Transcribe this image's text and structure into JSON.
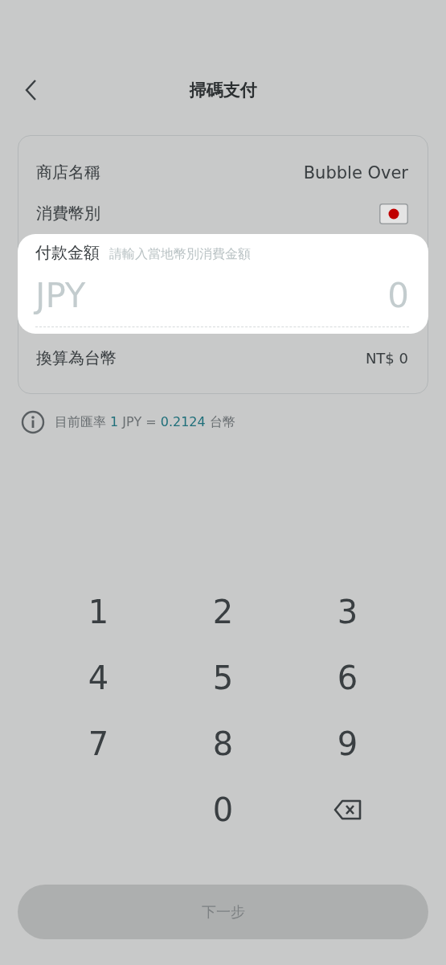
{
  "header": {
    "title": "掃碼支付"
  },
  "details": [
    {
      "label": "商店名稱",
      "value": "Bubble Over",
      "kind": "text"
    },
    {
      "label": "消費幣別",
      "kind": "flag"
    }
  ],
  "amount": {
    "label": "付款金額",
    "placeholder": "請輸入當地幣別消費金額",
    "currency": "JPY",
    "value": "0",
    "selected": true
  },
  "conversion": {
    "label": "換算為台幣",
    "value": "NT$ 0"
  },
  "rate": [
    {
      "text": "目前匯率 ",
      "highlight": false
    },
    {
      "text": "1",
      "highlight": true
    },
    {
      "text": " JPY = ",
      "highlight": false
    },
    {
      "text": "0.2124",
      "highlight": true
    },
    {
      "text": " 台幣",
      "highlight": false
    }
  ],
  "keypad": [
    {
      "kind": "digit",
      "label": "1"
    },
    {
      "kind": "digit",
      "label": "2"
    },
    {
      "kind": "digit",
      "label": "3"
    },
    {
      "kind": "digit",
      "label": "4"
    },
    {
      "kind": "digit",
      "label": "5"
    },
    {
      "kind": "digit",
      "label": "6"
    },
    {
      "kind": "digit",
      "label": "7"
    },
    {
      "kind": "digit",
      "label": "8"
    },
    {
      "kind": "digit",
      "label": "9"
    },
    {
      "kind": "blank"
    },
    {
      "kind": "digit",
      "label": "0"
    },
    {
      "kind": "backspace"
    }
  ],
  "next_button": {
    "label": "下一步",
    "disabled": true
  }
}
